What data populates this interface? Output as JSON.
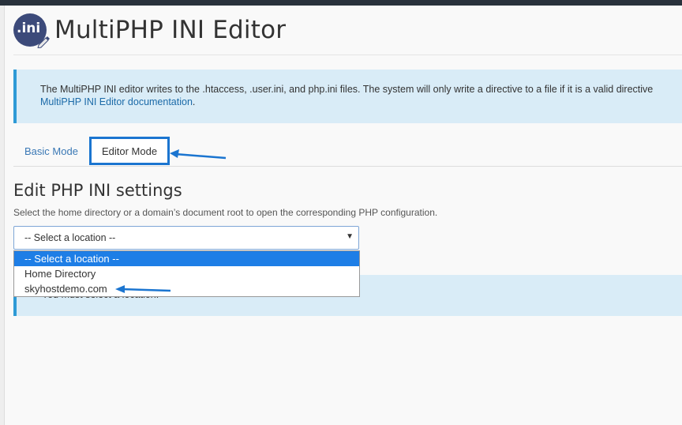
{
  "header": {
    "logo_text": ".ini",
    "title": "MultiPHP INI Editor"
  },
  "info": {
    "text": "The MultiPHP INI editor writes to the .htaccess, .user.ini, and php.ini files. The system will only write a directive to a file if it is a valid directive",
    "link_text": "MultiPHP INI Editor documentation",
    "after_link": "."
  },
  "tabs": [
    {
      "label": "Basic Mode",
      "active": false
    },
    {
      "label": "Editor Mode",
      "active": true
    }
  ],
  "section": {
    "title": "Edit PHP INI settings",
    "description": "Select the home directory or a domain’s document root to open the corresponding PHP configuration."
  },
  "location_select": {
    "value": "-- Select a location --",
    "options": [
      "-- Select a location --",
      "Home Directory",
      "skyhostdemo.com"
    ]
  },
  "alert": {
    "text": "You must select a location."
  },
  "colors": {
    "accent": "#1b75d0",
    "info_bg": "#d9ecf7",
    "info_border": "#2e9ad6",
    "link": "#1b6aa8",
    "dropdown_selected": "#1e7ee6"
  }
}
